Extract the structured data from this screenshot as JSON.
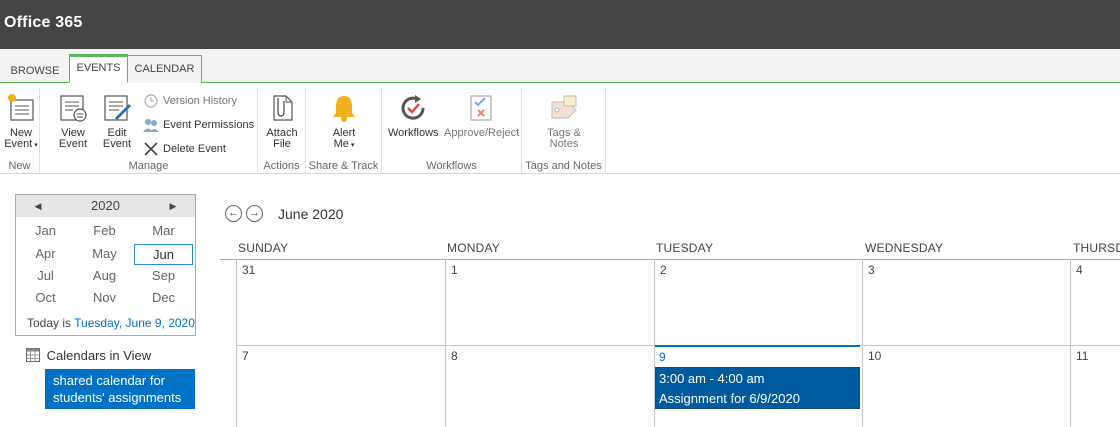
{
  "suite": {
    "brand": "Office 365"
  },
  "ribbon_tabs": [
    {
      "label": "BROWSE"
    },
    {
      "label": "EVENTS",
      "active": true
    },
    {
      "label": "CALENDAR"
    }
  ],
  "ribbon": {
    "new": {
      "group_label": "New",
      "new_event_line1": "New",
      "new_event_line2": "Event"
    },
    "manage": {
      "group_label": "Manage",
      "view_event_line1": "View",
      "view_event_line2": "Event",
      "edit_event_line1": "Edit",
      "edit_event_line2": "Event",
      "version_history": "Version History",
      "event_permissions": "Event Permissions",
      "delete_event": "Delete Event"
    },
    "actions": {
      "group_label": "Actions",
      "attach_line1": "Attach",
      "attach_line2": "File"
    },
    "share": {
      "group_label": "Share & Track",
      "alert_line1": "Alert",
      "alert_line2": "Me"
    },
    "workflows": {
      "group_label": "Workflows",
      "workflows": "Workflows",
      "approve_reject": "Approve/Reject"
    },
    "tags": {
      "group_label": "Tags and Notes",
      "tags_line1": "Tags &",
      "tags_line2": "Notes"
    }
  },
  "datepicker": {
    "year": "2020",
    "months": [
      "Jan",
      "Feb",
      "Mar",
      "Apr",
      "May",
      "Jun",
      "Jul",
      "Aug",
      "Sep",
      "Oct",
      "Nov",
      "Dec"
    ],
    "selected_month": "Jun",
    "today_prefix": "Today is",
    "today_link": "Tuesday, June 9, 2020"
  },
  "calendars_in_view": {
    "title": "Calendars in View",
    "item": "shared calendar for students' assignments"
  },
  "calendar": {
    "month_title": "June 2020",
    "day_headers": [
      "SUNDAY",
      "MONDAY",
      "TUESDAY",
      "WEDNESDAY",
      "THURSD"
    ],
    "week1": [
      "31",
      "1",
      "2",
      "3",
      "4"
    ],
    "week2": [
      "7",
      "8",
      "9",
      "10",
      "11"
    ],
    "today": "9",
    "event": {
      "time": "3:00 am - 4:00 am",
      "title": "Assignment for 6/9/2020"
    }
  },
  "colors": {
    "suite_bar": "#444444",
    "accent_green": "#5bb75b",
    "link_blue": "#0072c6",
    "event_blue": "#005a9e"
  }
}
